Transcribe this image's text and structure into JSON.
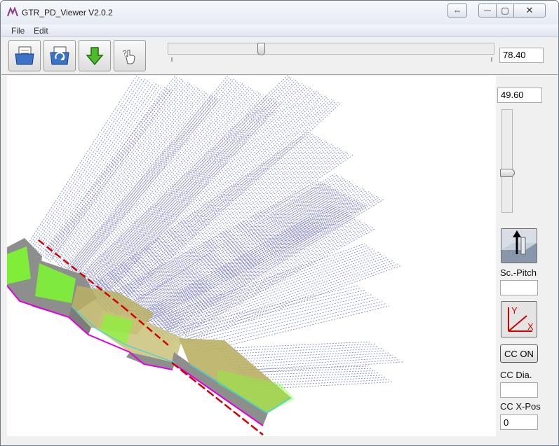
{
  "window": {
    "title": "GTR_PD_Viewer  V2.0.2",
    "buttons": {
      "restore_glyph": "⇔",
      "minimize_glyph": "—",
      "maximize_glyph": "▢",
      "close_glyph": "✕"
    }
  },
  "menu": {
    "items": [
      {
        "label": "File"
      },
      {
        "label": "Edit"
      }
    ]
  },
  "toolbar": {
    "tools": [
      {
        "icon": "open-file-icon"
      },
      {
        "icon": "reload-icon"
      },
      {
        "icon": "download-arrow-icon"
      },
      {
        "icon": "hand-pointer-icon"
      }
    ],
    "slider": {
      "position_fraction": 0.28
    },
    "value": "78.40"
  },
  "sidebar": {
    "value": "49.60",
    "vslider": {
      "position_fraction": 0.62
    },
    "labels": {
      "scale_pitch": "Sc.-Pitch",
      "cc_dia": "CC Dia.",
      "cc_xpos": "CC X-Pos"
    },
    "axis_button": {
      "y_label": "Y",
      "x_label": "X"
    },
    "cc_on_label": "CC ON",
    "inputs": {
      "scale_pitch_value": "",
      "cc_dia_value": "",
      "cc_xpos_value": "0"
    }
  },
  "colors": {
    "toolpath": "#7b80c0",
    "surface_green": "#7cff2a",
    "surface_gray": "#8c8f8c",
    "surface_khaki": "#b9b064",
    "edge_red": "#d40000",
    "edge_magenta": "#e000e0",
    "edge_cyan": "#40d0e0"
  }
}
